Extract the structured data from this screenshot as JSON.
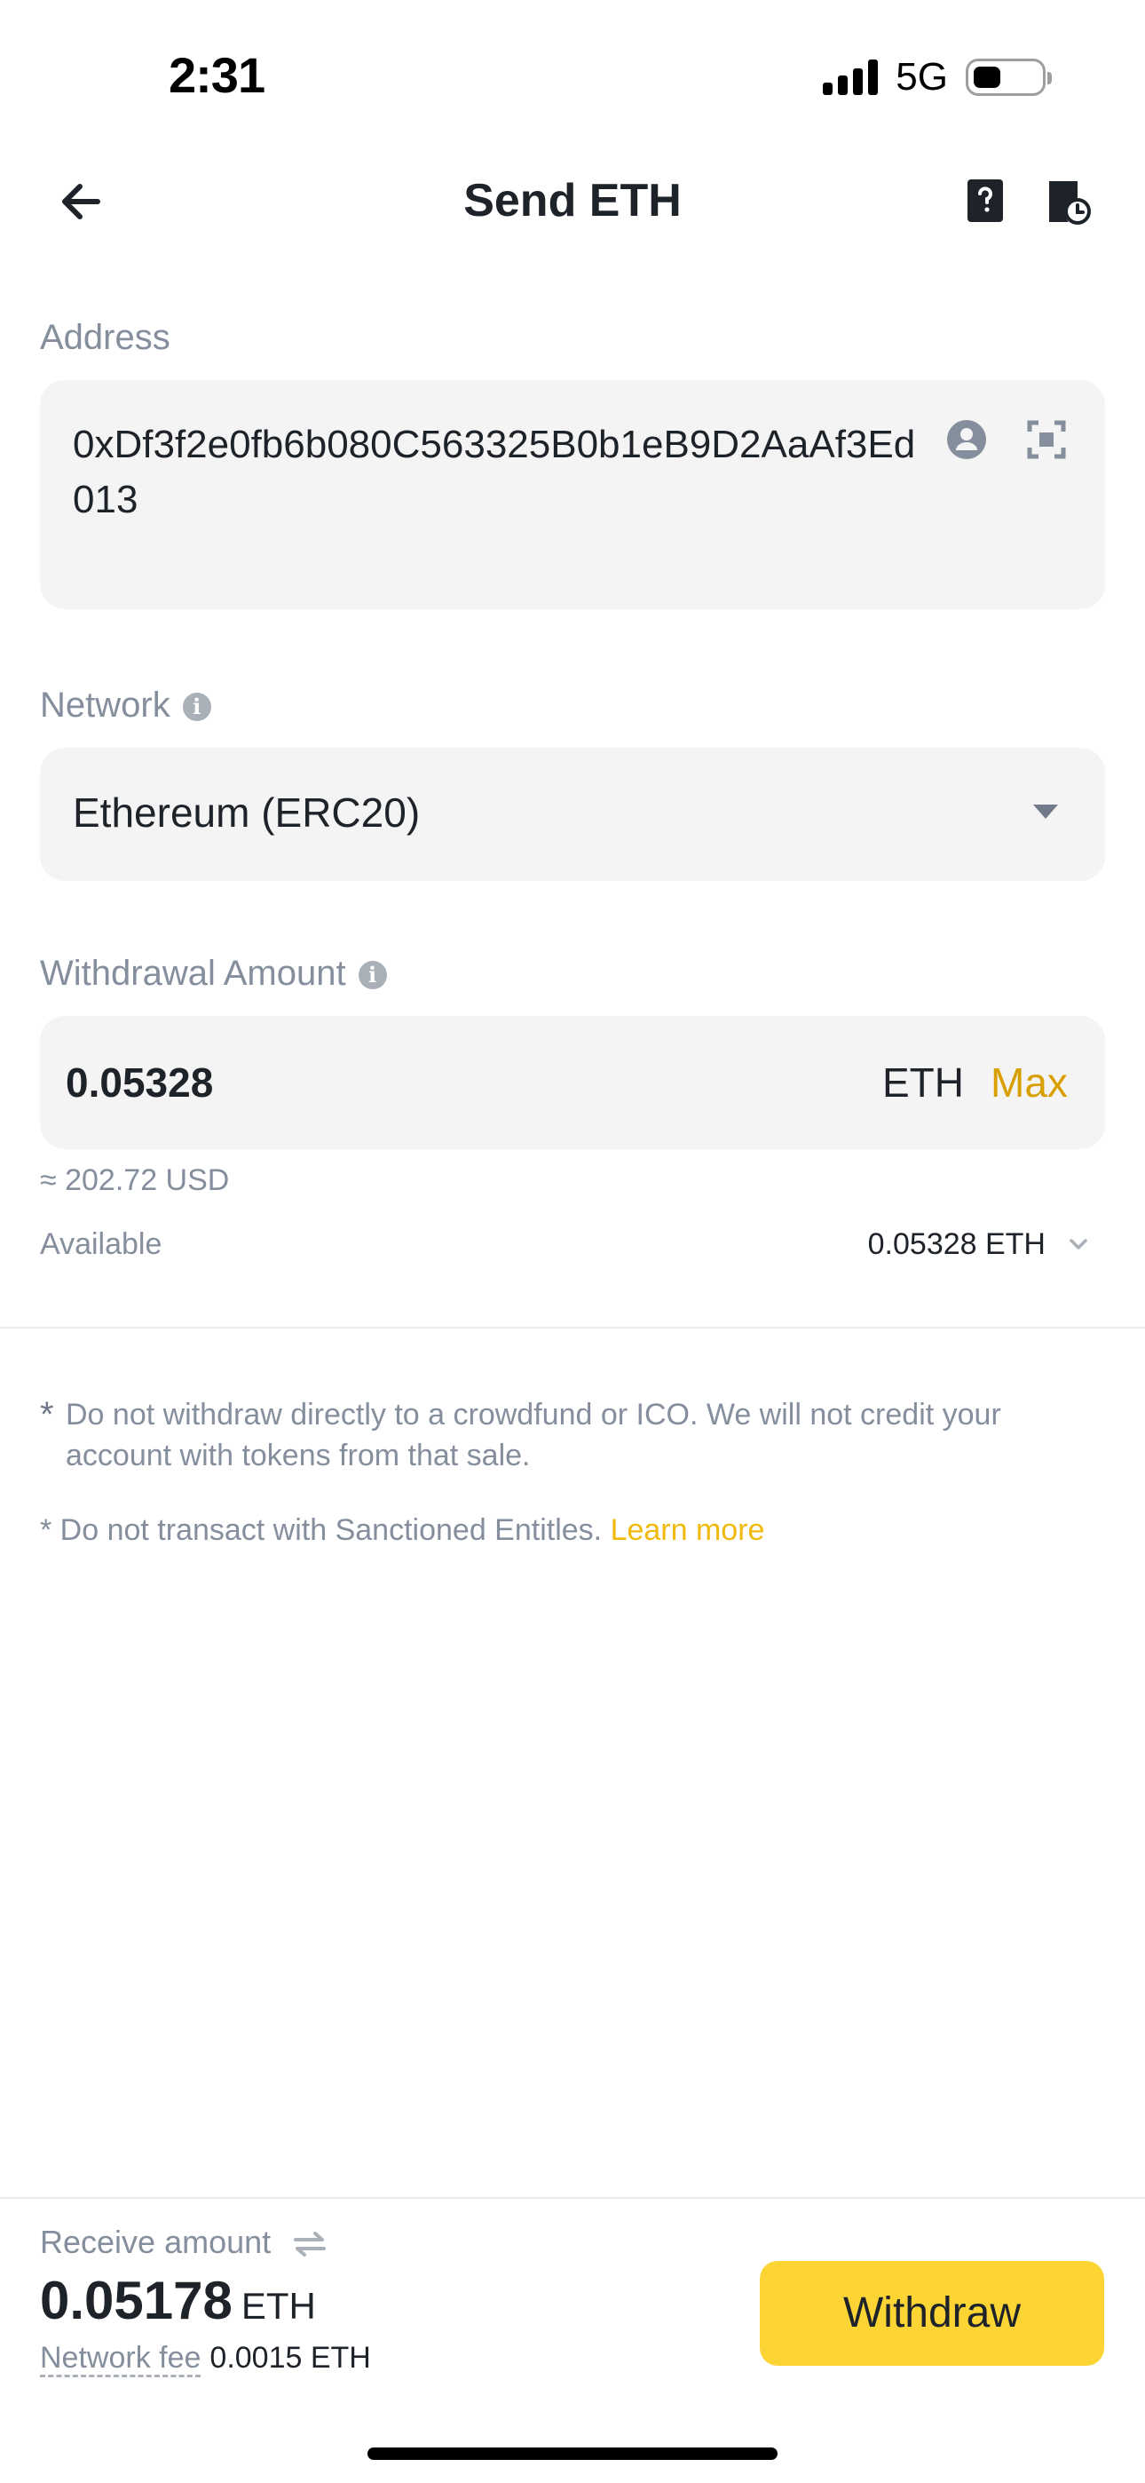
{
  "status_bar": {
    "time": "2:31",
    "network": "5G"
  },
  "header": {
    "title": "Send ETH"
  },
  "address": {
    "label": "Address",
    "value": "0xDf3f2e0fb6b080C563325B0b1eB9D2AaAf3Ed013"
  },
  "network": {
    "label": "Network",
    "selected": "Ethereum (ERC20)"
  },
  "withdrawal": {
    "label": "Withdrawal Amount",
    "amount": "0.05328",
    "unit": "ETH",
    "max_label": "Max",
    "usd_estimate": "≈ 202.72 USD",
    "available_label": "Available",
    "available_value": "0.05328 ETH"
  },
  "notes": {
    "note1": "Do not withdraw directly to a crowdfund or ICO. We will not credit your account with tokens from that sale.",
    "note2": "* Do not transact with Sanctioned Entitles.",
    "learn_more": "Learn more"
  },
  "bottom": {
    "receive_label": "Receive amount",
    "receive_amount": "0.05178",
    "receive_unit": "ETH",
    "fee_label": "Network fee",
    "fee_value": "0.0015 ETH",
    "withdraw_label": "Withdraw"
  },
  "colors": {
    "accent": "#fcd535",
    "max": "#d89f00",
    "link": "#f0b90b",
    "muted": "#848e9c"
  },
  "icons": [
    "back-arrow-icon",
    "help-document-icon",
    "history-document-icon",
    "info-icon",
    "contact-icon",
    "scan-icon",
    "dropdown-caret-icon",
    "chevron-down-icon",
    "swap-icon"
  ]
}
